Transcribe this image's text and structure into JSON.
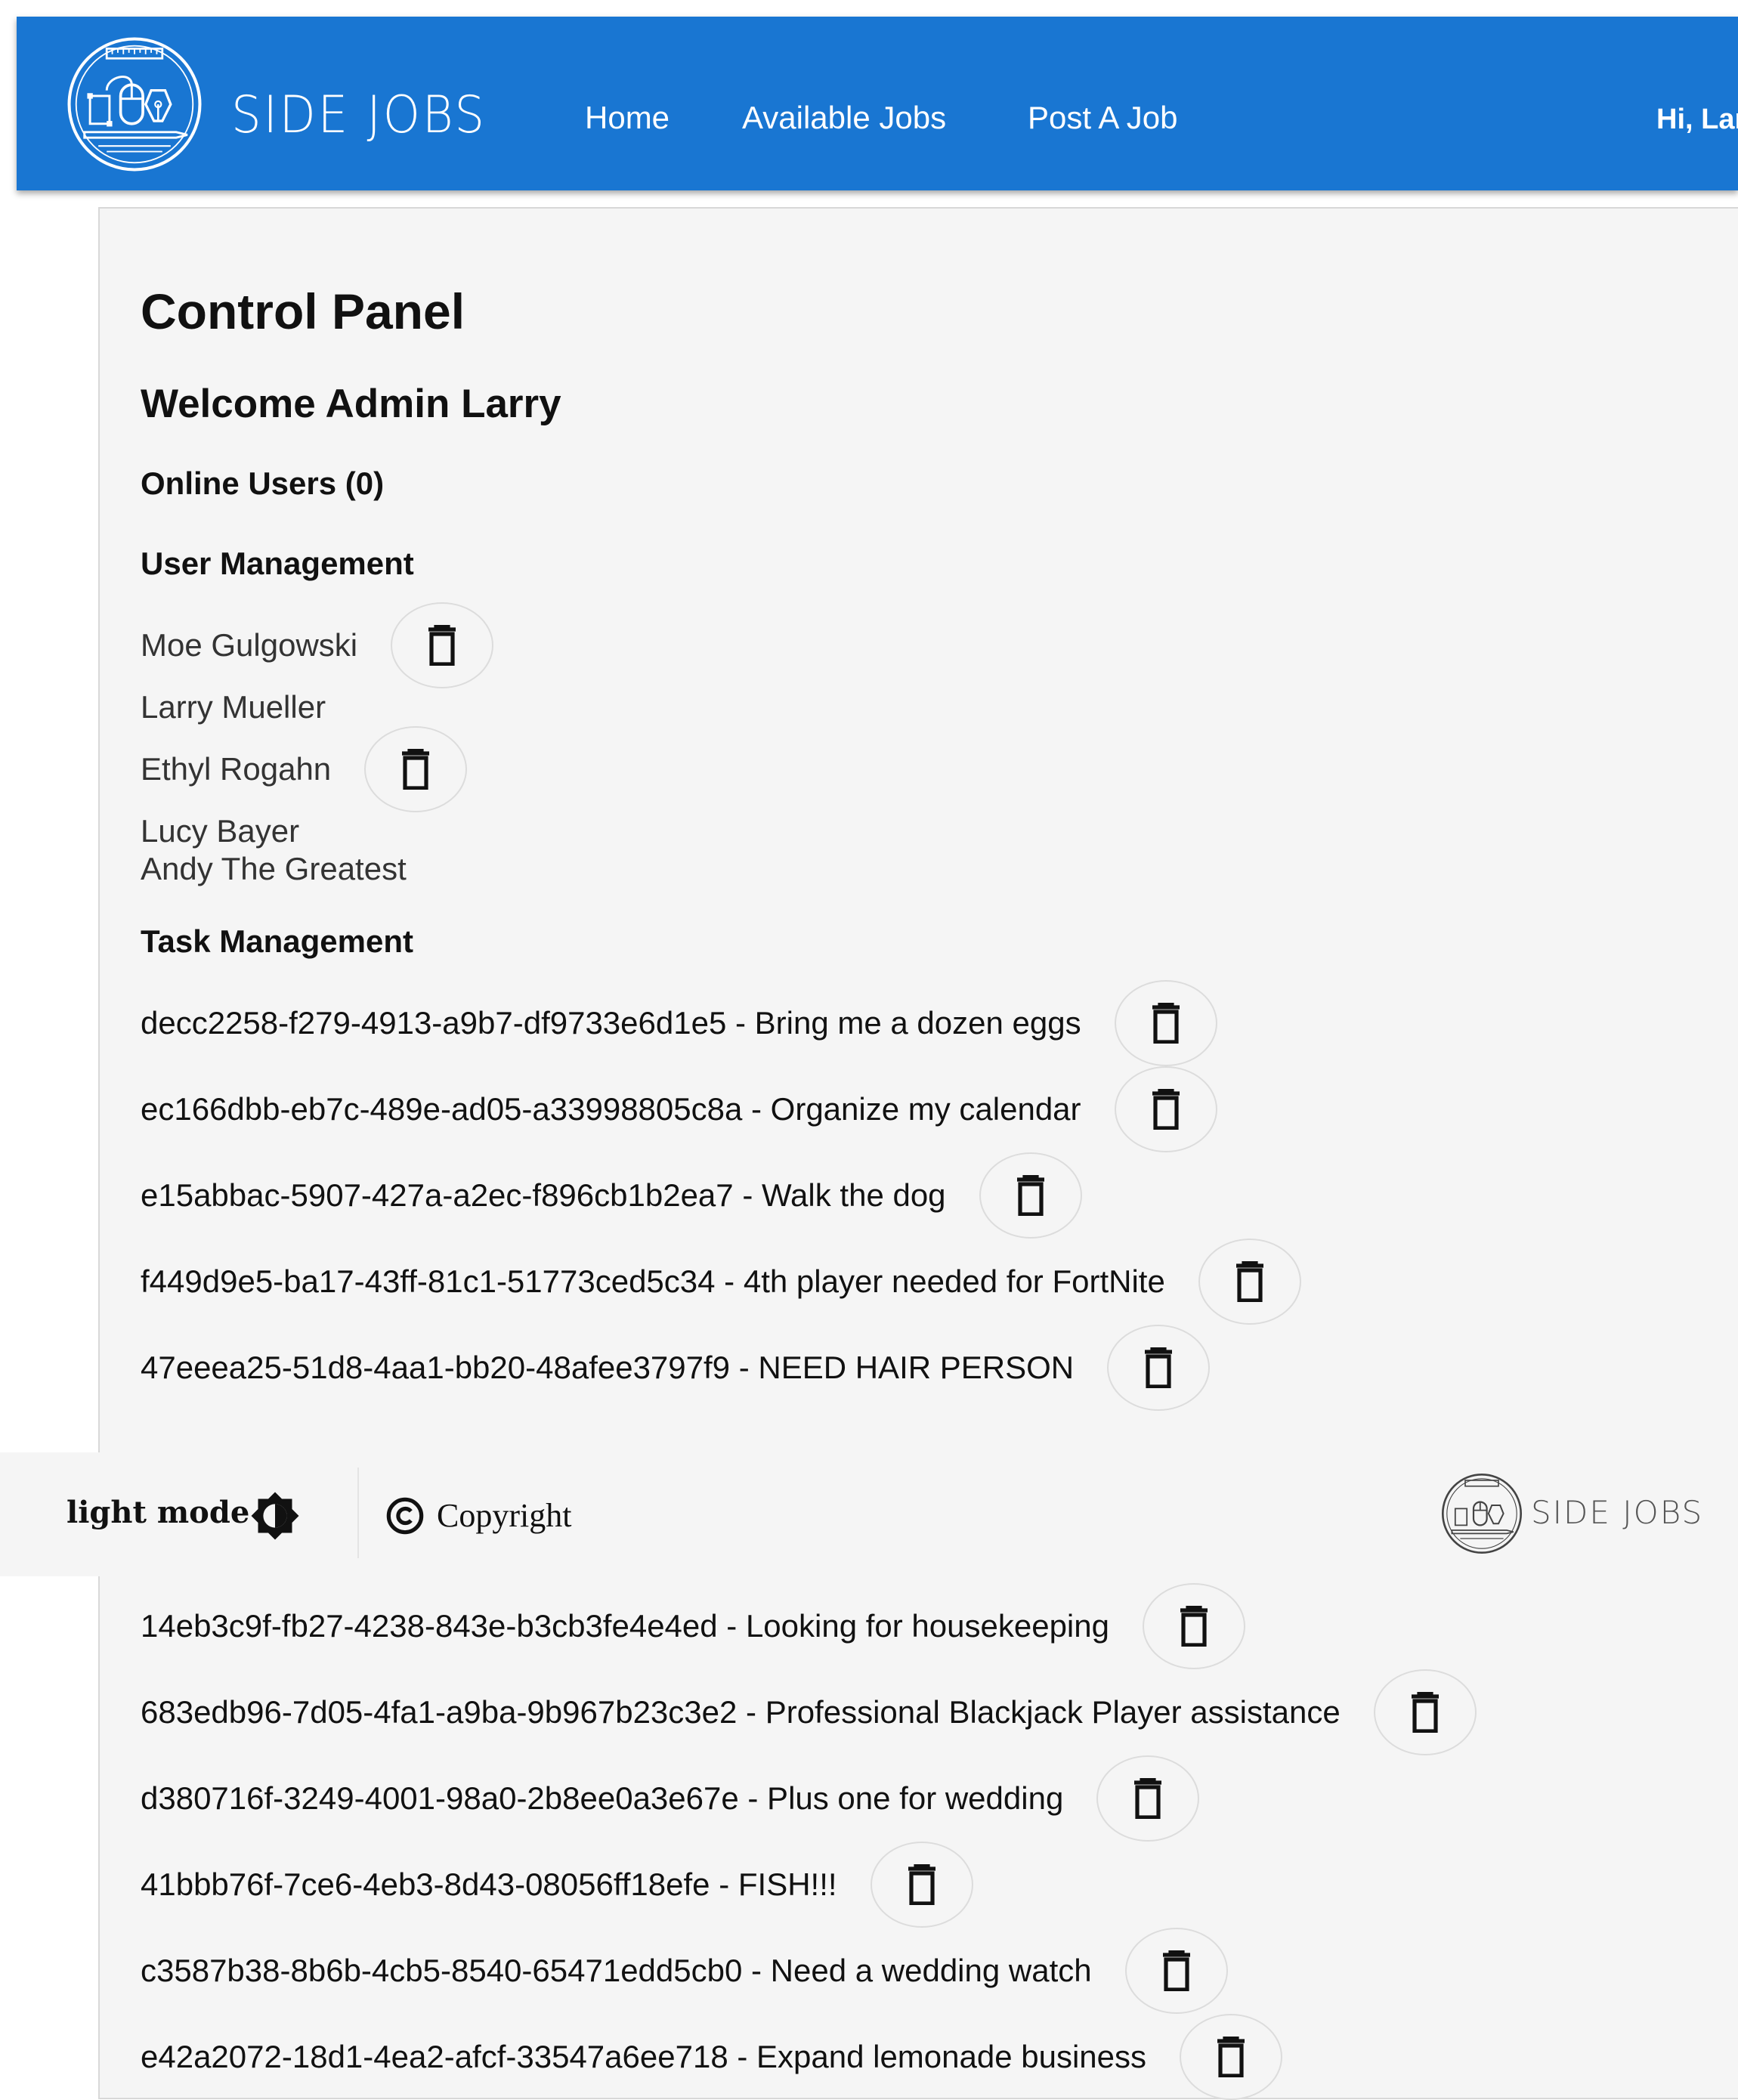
{
  "header": {
    "brand": "SIDE JOBS",
    "nav": [
      "Home",
      "Available Jobs",
      "Post A Job"
    ],
    "greeting": "Hi, Larr",
    "color": "#1976d2"
  },
  "main": {
    "title": "Control Panel",
    "welcome": "Welcome Admin Larry",
    "online_users": "Online Users (0)",
    "user_management": "User Management",
    "task_management": "Task Management",
    "users": [
      {
        "name": "Moe Gulgowski",
        "deletable": true
      },
      {
        "name": "Larry Mueller",
        "deletable": false
      },
      {
        "name": "Ethyl Rogahn",
        "deletable": true
      },
      {
        "name": "Lucy Bayer",
        "deletable": false
      },
      {
        "name": "Andy The Greatest",
        "deletable": false
      }
    ],
    "tasks": [
      "decc2258-f279-4913-a9b7-df9733e6d1e5 - Bring me a dozen eggs",
      "ec166dbb-eb7c-489e-ad05-a33998805c8a - Organize my calendar",
      "e15abbac-5907-427a-a2ec-f896cb1b2ea7 - Walk the dog",
      "f449d9e5-ba17-43ff-81c1-51773ced5c34 - 4th player needed for FortNite",
      "47eeea25-51d8-4aa1-bb20-48afee3797f9 - NEED HAIR PERSON",
      "14eb3c9f-fb27-4238-843e-b3cb3fe4e4ed - Looking for housekeeping",
      "683edb96-7d05-4fa1-a9ba-9b967b23c3e2 - Professional Blackjack Player assistance",
      "d380716f-3249-4001-98a0-2b8ee0a3e67e - Plus one for wedding",
      "41bbb76f-7ce6-4eb3-8d43-08056ff18efe - FISH!!!",
      "c3587b38-8b6b-4cb5-8540-65471edd5cb0 - Need a wedding watch",
      "e42a2072-18d1-4ea2-afcf-33547a6ee718 - Expand lemonade business"
    ]
  },
  "footer": {
    "mode_label": "light mode",
    "copyright": "Copyright",
    "brand": "SIDE JOBS"
  },
  "icons": {
    "delete": "trash-icon",
    "mode": "brightness-icon",
    "copyright": "copyright-icon",
    "logo": "side-jobs-logo-icon"
  }
}
